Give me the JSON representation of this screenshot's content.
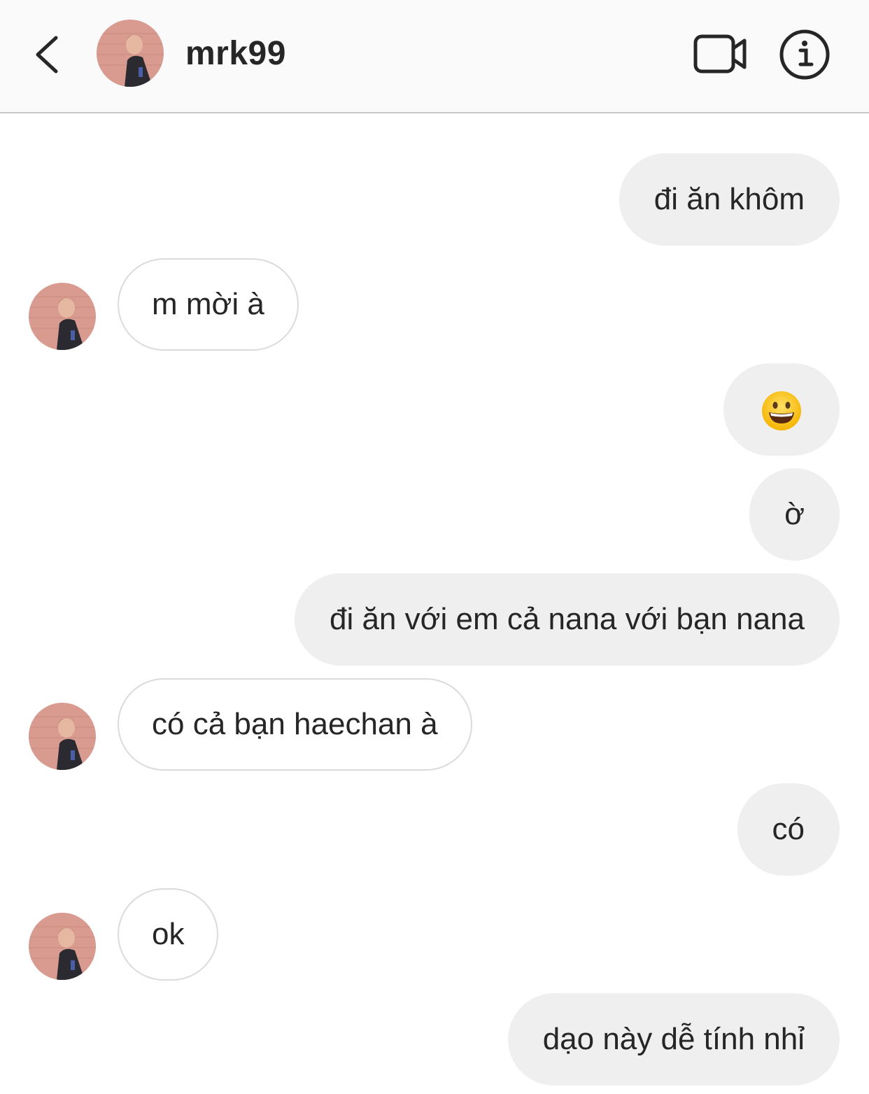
{
  "header": {
    "username": "mrk99",
    "back_icon": "chevron-left-icon",
    "video_icon": "video-camera-icon",
    "info_icon": "info-icon"
  },
  "colors": {
    "header_bg": "#fafafa",
    "my_bubble_bg": "#efefef",
    "their_bubble_border": "#dbdbdb",
    "text": "#262626",
    "avatar_bg": "#d99a90"
  },
  "messages": [
    {
      "sender": "me",
      "text": "đi ăn khôm"
    },
    {
      "sender": "them",
      "text": "m mời à"
    },
    {
      "sender": "me",
      "text": "😀",
      "emoji": "grinning-face"
    },
    {
      "sender": "me",
      "text": "ờ"
    },
    {
      "sender": "me",
      "text": "đi ăn với em cả nana với bạn nana"
    },
    {
      "sender": "them",
      "text": "có cả bạn haechan à"
    },
    {
      "sender": "me",
      "text": "có"
    },
    {
      "sender": "them",
      "text": "ok"
    },
    {
      "sender": "me",
      "text": "dạo này dễ tính nhỉ"
    }
  ]
}
